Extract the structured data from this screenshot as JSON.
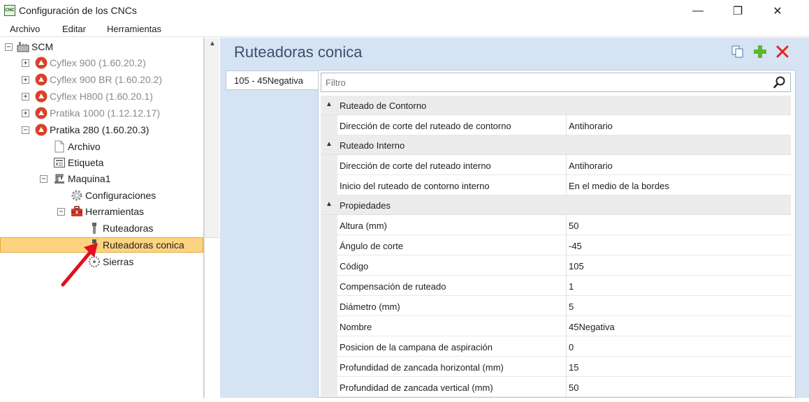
{
  "window": {
    "title": "Configuración de los CNCs",
    "icon_text": "CNC",
    "minimize": "—",
    "restore": "❐",
    "close": "✕"
  },
  "menu": [
    "Archivo",
    "Editar",
    "Herramientas"
  ],
  "tree": {
    "root": "SCM",
    "machines": [
      {
        "label": "Cyflex 900 (1.60.20.2)"
      },
      {
        "label": "Cyflex 900 BR (1.60.20.2)"
      },
      {
        "label": "Cyflex H800 (1.60.20.1)"
      },
      {
        "label": "Pratika 1000 (1.12.12.17)"
      },
      {
        "label": "Pratika 280 (1.60.20.3)"
      }
    ],
    "children": {
      "archivo": "Archivo",
      "etiqueta": "Etiqueta",
      "maquina": "Maquina1",
      "configuraciones": "Configuraciones",
      "herramientas": "Herramientas",
      "ruteadoras": "Ruteadoras",
      "ruteadoras_conica": "Ruteadoras conica",
      "sierras": "Sierras"
    },
    "expand_plus": "+",
    "expand_minus": "−"
  },
  "content": {
    "title": "Ruteadoras conica",
    "tab": "105 - 45Negativa",
    "filter_placeholder": "Filtro",
    "categories": [
      {
        "label": "Ruteado de Contorno",
        "props": [
          {
            "name": "Dirección de corte del ruteado de contorno",
            "value": "Antihorario"
          }
        ]
      },
      {
        "label": "Ruteado Interno",
        "props": [
          {
            "name": "Dirección de corte del ruteado interno",
            "value": "Antihorario"
          },
          {
            "name": "Inicio del ruteado de contorno interno",
            "value": "En el medio de la bordes"
          }
        ]
      },
      {
        "label": "Propiedades",
        "props": [
          {
            "name": "Altura (mm)",
            "value": "50"
          },
          {
            "name": "Ángulo de corte",
            "value": "-45"
          },
          {
            "name": "Código",
            "value": "105"
          },
          {
            "name": "Compensación de ruteado",
            "value": "1"
          },
          {
            "name": "Diámetro (mm)",
            "value": "5"
          },
          {
            "name": "Nombre",
            "value": "45Negativa"
          },
          {
            "name": "Posicion de la campana de aspiración",
            "value": "0"
          },
          {
            "name": "Profundidad de zancada horizontal (mm)",
            "value": "15"
          },
          {
            "name": "Profundidad de zancada vertical (mm)",
            "value": "50"
          }
        ]
      }
    ]
  },
  "colors": {
    "selection": "#fcd381",
    "content_bg": "#d6e3f3",
    "machine_icon": "#d9412a",
    "arrow": "#e0101e"
  }
}
